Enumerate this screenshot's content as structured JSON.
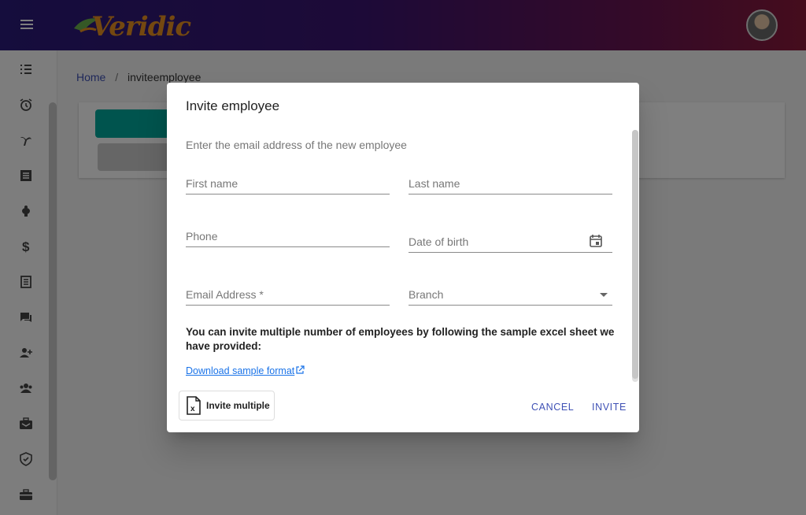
{
  "header": {
    "logo_text": "Veridic",
    "menu_icon": "hamburger-menu-icon",
    "avatar_icon": "user-avatar"
  },
  "sidebar": {
    "icons": [
      "tasks-list-icon",
      "alarm-clock-icon",
      "palm-tree-icon",
      "document-list-icon",
      "piggy-bank-icon",
      "dollar-icon",
      "receipt-icon",
      "chat-icon",
      "add-user-icon",
      "group-icon",
      "briefcase-inbox-icon",
      "shield-check-icon",
      "toolbox-icon"
    ]
  },
  "breadcrumb": {
    "home": "Home",
    "separator": "/",
    "current": "inviteemployee"
  },
  "dialog": {
    "title": "Invite employee",
    "subtitle": "Enter the email address of the new employee",
    "fields": {
      "first_name": "First name",
      "last_name": "Last name",
      "phone": "Phone",
      "date_of_birth": "Date of birth",
      "email": "Email Address *",
      "branch": "Branch"
    },
    "info_text": "You can invite multiple number of employees by following the sample excel sheet we have provided:",
    "download_link": "Download sample format",
    "invite_multiple": "Invite multiple",
    "cancel": "CANCEL",
    "invite": "INVITE"
  },
  "colors": {
    "header_gradient_start": "#2a1a7a",
    "header_gradient_end": "#8a1a3a",
    "primary": "#3f51b5",
    "link": "#1a73e8",
    "teal": "#00a99d"
  }
}
